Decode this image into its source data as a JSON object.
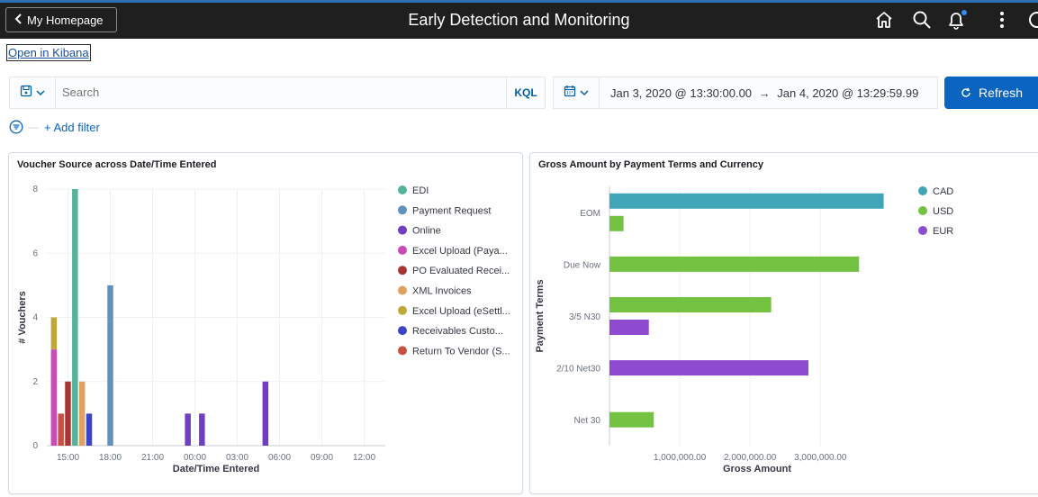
{
  "header": {
    "back_label": "My Homepage",
    "title": "Early Detection and Monitoring",
    "icons": [
      "home-icon",
      "search-icon",
      "bell-icon",
      "more-vertical-icon",
      "nav-icon"
    ]
  },
  "kibana_link": "Open in Kibana",
  "query_bar": {
    "search_placeholder": "Search",
    "kql_label": "KQL",
    "date_start": "Jan 3, 2020 @ 13:30:00.00",
    "date_arrow": "→",
    "date_end": "Jan 4, 2020 @ 13:29:59.99",
    "refresh_label": "Refresh"
  },
  "filters": {
    "dash": "—",
    "add_filter_label": "+ Add filter"
  },
  "panels": [
    {
      "title": "Voucher Source across Date/Time Entered"
    },
    {
      "title": "Gross Amount by Payment Terms and Currency"
    }
  ],
  "chart_data": [
    {
      "type": "bar",
      "title": "Voucher Source across Date/Time Entered",
      "xlabel": "Date/Time Entered",
      "ylabel": "# Vouchers",
      "ylim": [
        0,
        8
      ],
      "yticks": [
        0,
        2,
        4,
        6,
        8
      ],
      "xticks": [
        "15:00",
        "18:00",
        "21:00",
        "00:00",
        "03:00",
        "06:00",
        "09:00",
        "12:00"
      ],
      "x_range_hours": [
        13.5,
        37.5
      ],
      "grid": true,
      "legend_position": "right",
      "series": [
        {
          "name": "EDI",
          "color": "#54b399"
        },
        {
          "name": "Payment Request",
          "color": "#6092c0"
        },
        {
          "name": "Online",
          "color": "#6f3ec1"
        },
        {
          "name": "Excel Upload (Paya...",
          "color": "#ca4bb8"
        },
        {
          "name": "PO Evaluated Recei...",
          "color": "#a73535"
        },
        {
          "name": "XML Invoices",
          "color": "#e0a060"
        },
        {
          "name": "Excel Upload (eSettl...",
          "color": "#c0a838"
        },
        {
          "name": "Receivables Custo...",
          "color": "#3b45c8"
        },
        {
          "name": "Return To Vendor (S...",
          "color": "#c75043"
        }
      ],
      "bars": [
        {
          "hour": 14.0,
          "stack": [
            [
              "Excel Upload (Paya...",
              3
            ],
            [
              "Excel Upload (eSettl...",
              1
            ]
          ]
        },
        {
          "hour": 14.5,
          "stack": [
            [
              "Return To Vendor (S...",
              1
            ]
          ]
        },
        {
          "hour": 15.0,
          "stack": [
            [
              "PO Evaluated Recei...",
              2
            ]
          ]
        },
        {
          "hour": 15.5,
          "stack": [
            [
              "EDI",
              8
            ]
          ]
        },
        {
          "hour": 16.0,
          "stack": [
            [
              "XML Invoices",
              2
            ]
          ]
        },
        {
          "hour": 16.5,
          "stack": [
            [
              "Receivables Custo...",
              1
            ]
          ]
        },
        {
          "hour": 18.0,
          "stack": [
            [
              "Payment Request",
              5
            ]
          ]
        },
        {
          "hour": 23.5,
          "stack": [
            [
              "Online",
              1
            ]
          ]
        },
        {
          "hour": 24.5,
          "stack": [
            [
              "Online",
              1
            ]
          ]
        },
        {
          "hour": 29.0,
          "stack": [
            [
              "Online",
              2
            ]
          ]
        }
      ]
    },
    {
      "type": "bar",
      "orientation": "horizontal",
      "title": "Gross Amount by Payment Terms and Currency",
      "xlabel": "Gross Amount",
      "ylabel": "Payment Terms",
      "xlim": [
        0,
        4200000
      ],
      "xticks": [
        "1,000,000.00",
        "2,000,000.00",
        "3,000,000.00"
      ],
      "xtick_values": [
        1000000,
        2000000,
        3000000
      ],
      "grid": true,
      "legend_position": "right",
      "categories": [
        "EOM",
        "Due Now",
        "3/5 N30",
        "2/10 Net30",
        "Net 30"
      ],
      "series": [
        {
          "name": "CAD",
          "color": "#3fa5b7",
          "values": [
            3900000,
            0,
            0,
            0,
            0
          ]
        },
        {
          "name": "USD",
          "color": "#74c242",
          "values": [
            200000,
            3550000,
            2300000,
            0,
            630000
          ]
        },
        {
          "name": "EUR",
          "color": "#8f4bcf",
          "values": [
            0,
            0,
            560000,
            2830000,
            0
          ]
        }
      ]
    }
  ]
}
